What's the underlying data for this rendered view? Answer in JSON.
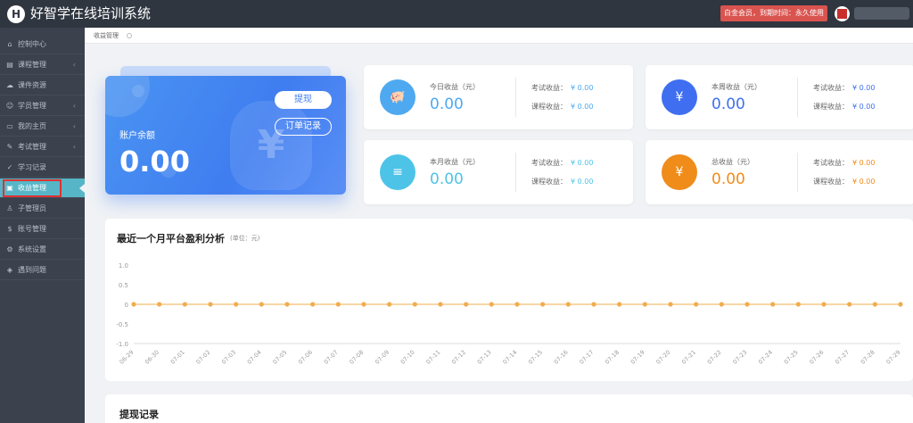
{
  "header": {
    "logo_letter": "H",
    "app_title": "好智学在线培训系统",
    "vip_badge": "白金会员，到期时间：永久使用"
  },
  "sidebar": {
    "items": [
      {
        "label": "控制中心",
        "icon": "home-icon",
        "has_submenu": false
      },
      {
        "label": "课程管理",
        "icon": "book-icon",
        "has_submenu": true
      },
      {
        "label": "课件资源",
        "icon": "cloud-icon",
        "has_submenu": false
      },
      {
        "label": "学员管理",
        "icon": "users-icon",
        "has_submenu": true
      },
      {
        "label": "我的主页",
        "icon": "page-icon",
        "has_submenu": true
      },
      {
        "label": "考试管理",
        "icon": "exam-icon",
        "has_submenu": true
      },
      {
        "label": "学习记录",
        "icon": "record-icon",
        "has_submenu": false
      },
      {
        "label": "收益管理",
        "icon": "wallet-icon",
        "has_submenu": false,
        "active": true
      },
      {
        "label": "子管理员",
        "icon": "admin-icon",
        "has_submenu": false
      },
      {
        "label": "账号管理",
        "icon": "account-icon",
        "has_submenu": false
      },
      {
        "label": "系统设置",
        "icon": "gear-icon",
        "has_submenu": false
      },
      {
        "label": "遇到问题",
        "icon": "help-icon",
        "has_submenu": false
      }
    ]
  },
  "breadcrumb": "收益管理",
  "balance": {
    "label": "账户余额",
    "value": "0.00",
    "withdraw_button": "提现",
    "orders_button": "订单记录"
  },
  "stats": [
    {
      "label": "今日收益（元）",
      "value": "0.00",
      "exam_label": "考试收益：",
      "exam_value": "¥ 0.00",
      "course_label": "课程收益：",
      "course_value": "¥ 0.00",
      "color": "#4ea9f0",
      "icon": "piggy-bank-icon"
    },
    {
      "label": "本周收益（元）",
      "value": "0.00",
      "exam_label": "考试收益：",
      "exam_value": "¥ 0.00",
      "course_label": "课程收益：",
      "course_value": "¥ 0.00",
      "color": "#3f6ff0",
      "icon": "yen-wallet-icon"
    },
    {
      "label": "本月收益（元）",
      "value": "0.00",
      "exam_label": "考试收益：",
      "exam_value": "¥ 0.00",
      "course_label": "课程收益：",
      "course_value": "¥ 0.00",
      "color": "#4ec3e8",
      "icon": "coins-icon"
    },
    {
      "label": "总收益（元）",
      "value": "0.00",
      "exam_label": "考试收益：",
      "exam_value": "¥ 0.00",
      "course_label": "课程收益：",
      "course_value": "¥ 0.00",
      "color": "#f08c1a",
      "icon": "money-bag-icon"
    }
  ],
  "chart_section": {
    "title": "最近一个月平台盈利分析",
    "unit": "(单位：元)"
  },
  "chart_data": {
    "type": "line",
    "x": [
      "06-29",
      "06-30",
      "07-01",
      "07-02",
      "07-03",
      "07-04",
      "07-05",
      "07-06",
      "07-07",
      "07-08",
      "07-09",
      "07-10",
      "07-11",
      "07-12",
      "07-13",
      "07-14",
      "07-15",
      "07-16",
      "07-17",
      "07-18",
      "07-19",
      "07-20",
      "07-21",
      "07-22",
      "07-23",
      "07-24",
      "07-25",
      "07-26",
      "07-27",
      "07-28",
      "07-29"
    ],
    "series": [
      {
        "values": [
          0,
          0,
          0,
          0,
          0,
          0,
          0,
          0,
          0,
          0,
          0,
          0,
          0,
          0,
          0,
          0,
          0,
          0,
          0,
          0,
          0,
          0,
          0,
          0,
          0,
          0,
          0,
          0,
          0,
          0,
          0
        ],
        "color": "#f0ad4e"
      }
    ],
    "yticks": [
      "1.0",
      "0.5",
      "0",
      "-0.5",
      "-1.0"
    ],
    "ylim": [
      -1.0,
      1.0
    ],
    "grid": false,
    "title": "",
    "xlabel": "",
    "ylabel": ""
  },
  "withdrawals": {
    "title": "提现记录"
  }
}
